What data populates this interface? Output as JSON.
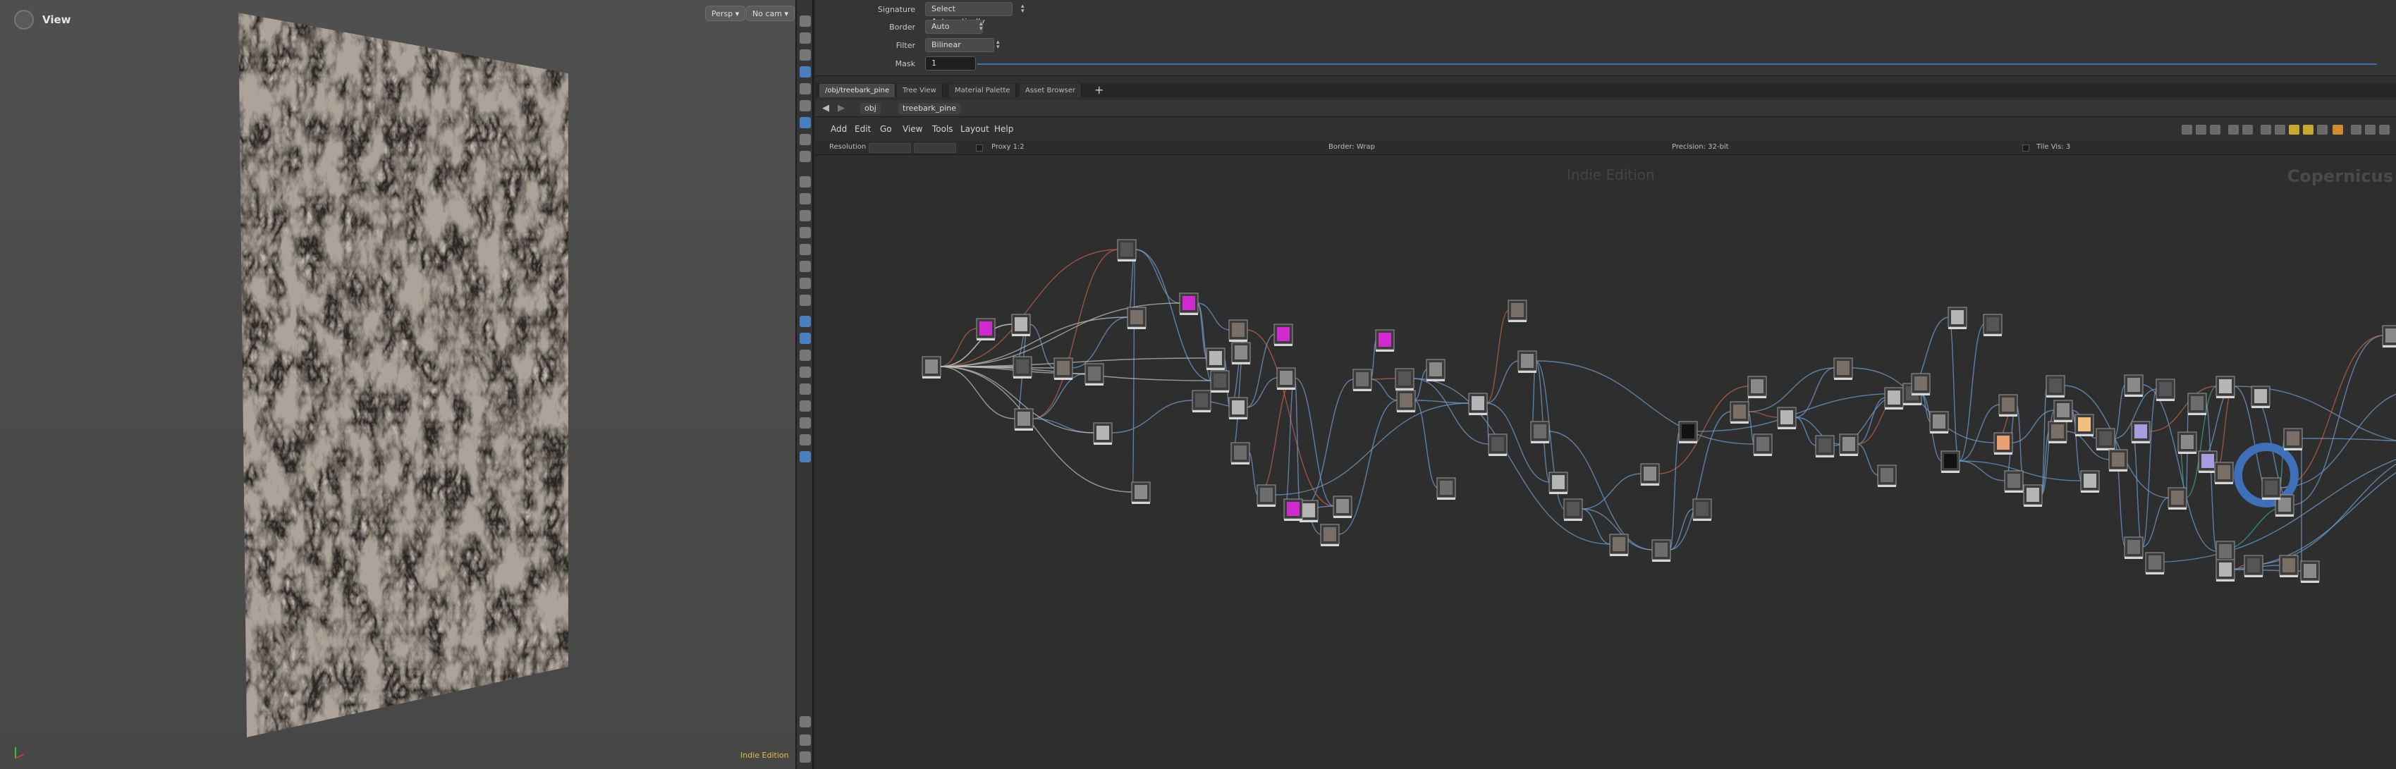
{
  "viewport": {
    "title": "View",
    "persp_label": "Persp ▾",
    "cam_label": "No cam ▾",
    "edition_label": "Indie Edition"
  },
  "parameters": {
    "signature": {
      "label": "Signature",
      "value": "Select Automatically"
    },
    "border": {
      "label": "Border",
      "value": "Auto"
    },
    "filter": {
      "label": "Filter",
      "value": "Bilinear"
    },
    "mask": {
      "label": "Mask",
      "value": "1"
    }
  },
  "tabs": [
    {
      "label": "/obj/treebark_pine",
      "active": true
    },
    {
      "label": "Tree View",
      "active": false
    },
    {
      "label": "Material Palette",
      "active": false
    },
    {
      "label": "Asset Browser",
      "active": false
    }
  ],
  "tab_add_label": "+",
  "pathbar": {
    "back_icon": "arrow-left-icon",
    "forward_icon": "arrow-right-icon",
    "crumbs": [
      "obj",
      "treebark_pine"
    ]
  },
  "menubar": {
    "items": [
      "Add",
      "Edit",
      "Go",
      "View",
      "Tools",
      "Layout",
      "Help"
    ]
  },
  "statusbar": {
    "resolution_label": "Resolution",
    "proxy_label": "Proxy 1:2",
    "border_label": "Border: Wrap",
    "precision_label": "Precision: 32-bit",
    "tile_label": "Tile Vis: 3"
  },
  "network": {
    "watermark": "Indie Edition",
    "context_label": "Copernicus"
  },
  "colors": {
    "accent_blue": "#3d6fae",
    "wire_blue": "#6f9ccc",
    "wire_red": "#c0604a",
    "wire_teal": "#3aa58a",
    "node_magenta": "#d02ad0",
    "edition_yellow": "#e0c040"
  }
}
